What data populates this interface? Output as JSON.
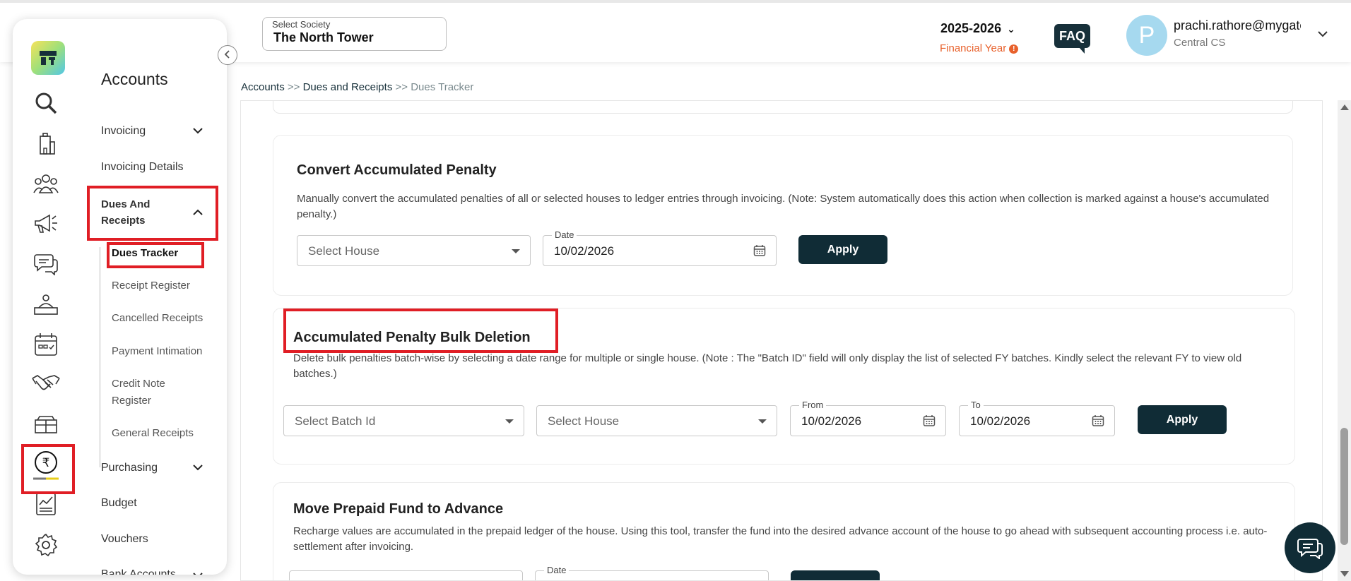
{
  "header": {
    "society_label": "Select Society",
    "society_value": "The North Tower",
    "financial_year": "2025-2026",
    "financial_year_label": "Financial Year",
    "faq_label": "FAQ",
    "avatar_letter": "P",
    "user_email": "prachi.rathore@mygate.com",
    "user_role": "Central CS"
  },
  "sidebar": {
    "title": "Accounts",
    "items": [
      {
        "label": "Invoicing"
      },
      {
        "label": "Invoicing Details"
      },
      {
        "label": "Dues And Receipts"
      },
      {
        "label": "Purchasing"
      },
      {
        "label": "Budget"
      },
      {
        "label": "Vouchers"
      },
      {
        "label": "Bank Accounts"
      }
    ],
    "subitems": [
      {
        "label": "Dues Tracker"
      },
      {
        "label": "Receipt Register"
      },
      {
        "label": "Cancelled Receipts"
      },
      {
        "label": "Payment Intimation"
      },
      {
        "label": "Credit Note Register"
      },
      {
        "label": "General Receipts"
      }
    ],
    "rail_icons": [
      "search-icon",
      "building-icon",
      "community-icon",
      "megaphone-icon",
      "chat-icon",
      "helpdesk-icon",
      "calendar-icon",
      "handshake-icon",
      "amenities-icon",
      "rupee-icon",
      "reports-icon",
      "settings-icon"
    ]
  },
  "breadcrumb": {
    "part1": "Accounts",
    "sep": ">>",
    "part2": "Dues and Receipts",
    "part3": "Dues Tracker"
  },
  "sections": {
    "convert": {
      "title": "Convert Accumulated Penalty",
      "desc": "Manually convert the accumulated penalties of all or selected houses to ledger entries through invoicing. (Note: System automatically does this action when collection is marked against a house's accumulated penalty.)",
      "house_placeholder": "Select House",
      "date_label": "Date",
      "date_value": "10/02/2026",
      "apply_label": "Apply"
    },
    "bulk_delete": {
      "title": "Accumulated Penalty Bulk Deletion",
      "desc": "Delete bulk penalties batch-wise by selecting a date range for multiple or single house. (Note : The \"Batch ID\" field will only display the list of selected FY batches. Kindly select the relevant FY to view old batches.)",
      "batch_placeholder": "Select Batch Id",
      "house_placeholder": "Select House",
      "from_label": "From",
      "from_value": "10/02/2026",
      "to_label": "To",
      "to_value": "10/02/2026",
      "apply_label": "Apply"
    },
    "prepaid": {
      "title": "Move Prepaid Fund to Advance",
      "desc": "Recharge values are accumulated in the prepaid ledger of the house. Using this tool, transfer the fund into the desired advance account of the house to go ahead with subsequent accounting process i.e. auto-settlement after invoicing.",
      "date_label": "Date"
    }
  },
  "colors": {
    "primary": "#102c36",
    "highlight": "#e01e25",
    "warning": "#e8612c"
  }
}
